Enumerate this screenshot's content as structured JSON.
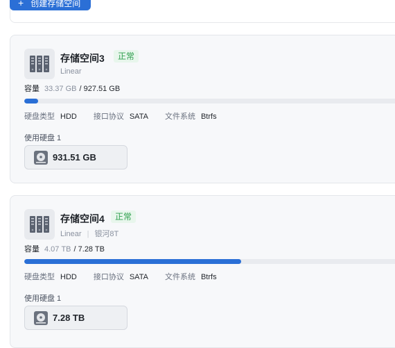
{
  "toolbar": {
    "create_label": "创建存储空间",
    "plus_glyph": "+"
  },
  "pools": [
    {
      "name": "存储空间3",
      "status": "正常",
      "raid": "Linear",
      "alias": "",
      "capacity_label": "容量",
      "used": "33.37 GB",
      "total": "/ 927.51 GB",
      "usage_fraction": 0.036,
      "disk_type_label": "硬盘类型",
      "disk_type": "HDD",
      "interface_label": "接口协议",
      "interface": "SATA",
      "fs_label": "文件系统",
      "fs": "Btrfs",
      "disks_label": "使用硬盘 1",
      "disk_size": "931.51 GB"
    },
    {
      "name": "存储空间4",
      "status": "正常",
      "raid": "Linear",
      "alias": "银河8T",
      "capacity_label": "容量",
      "used": "4.07 TB",
      "total": "/ 7.28 TB",
      "usage_fraction": 0.559,
      "disk_type_label": "硬盘类型",
      "disk_type": "HDD",
      "interface_label": "接口协议",
      "interface": "SATA",
      "fs_label": "文件系统",
      "fs": "Btrfs",
      "disks_label": "使用硬盘 1",
      "disk_size": "7.28 TB"
    }
  ],
  "colors": {
    "accent": "#2a6fd6",
    "status_ok": "#2e9f4d",
    "status_bg": "#e8f6ec"
  },
  "icons": {
    "pool": "server-rack-icon",
    "disk": "hard-disk-icon",
    "add": "plus-icon"
  }
}
